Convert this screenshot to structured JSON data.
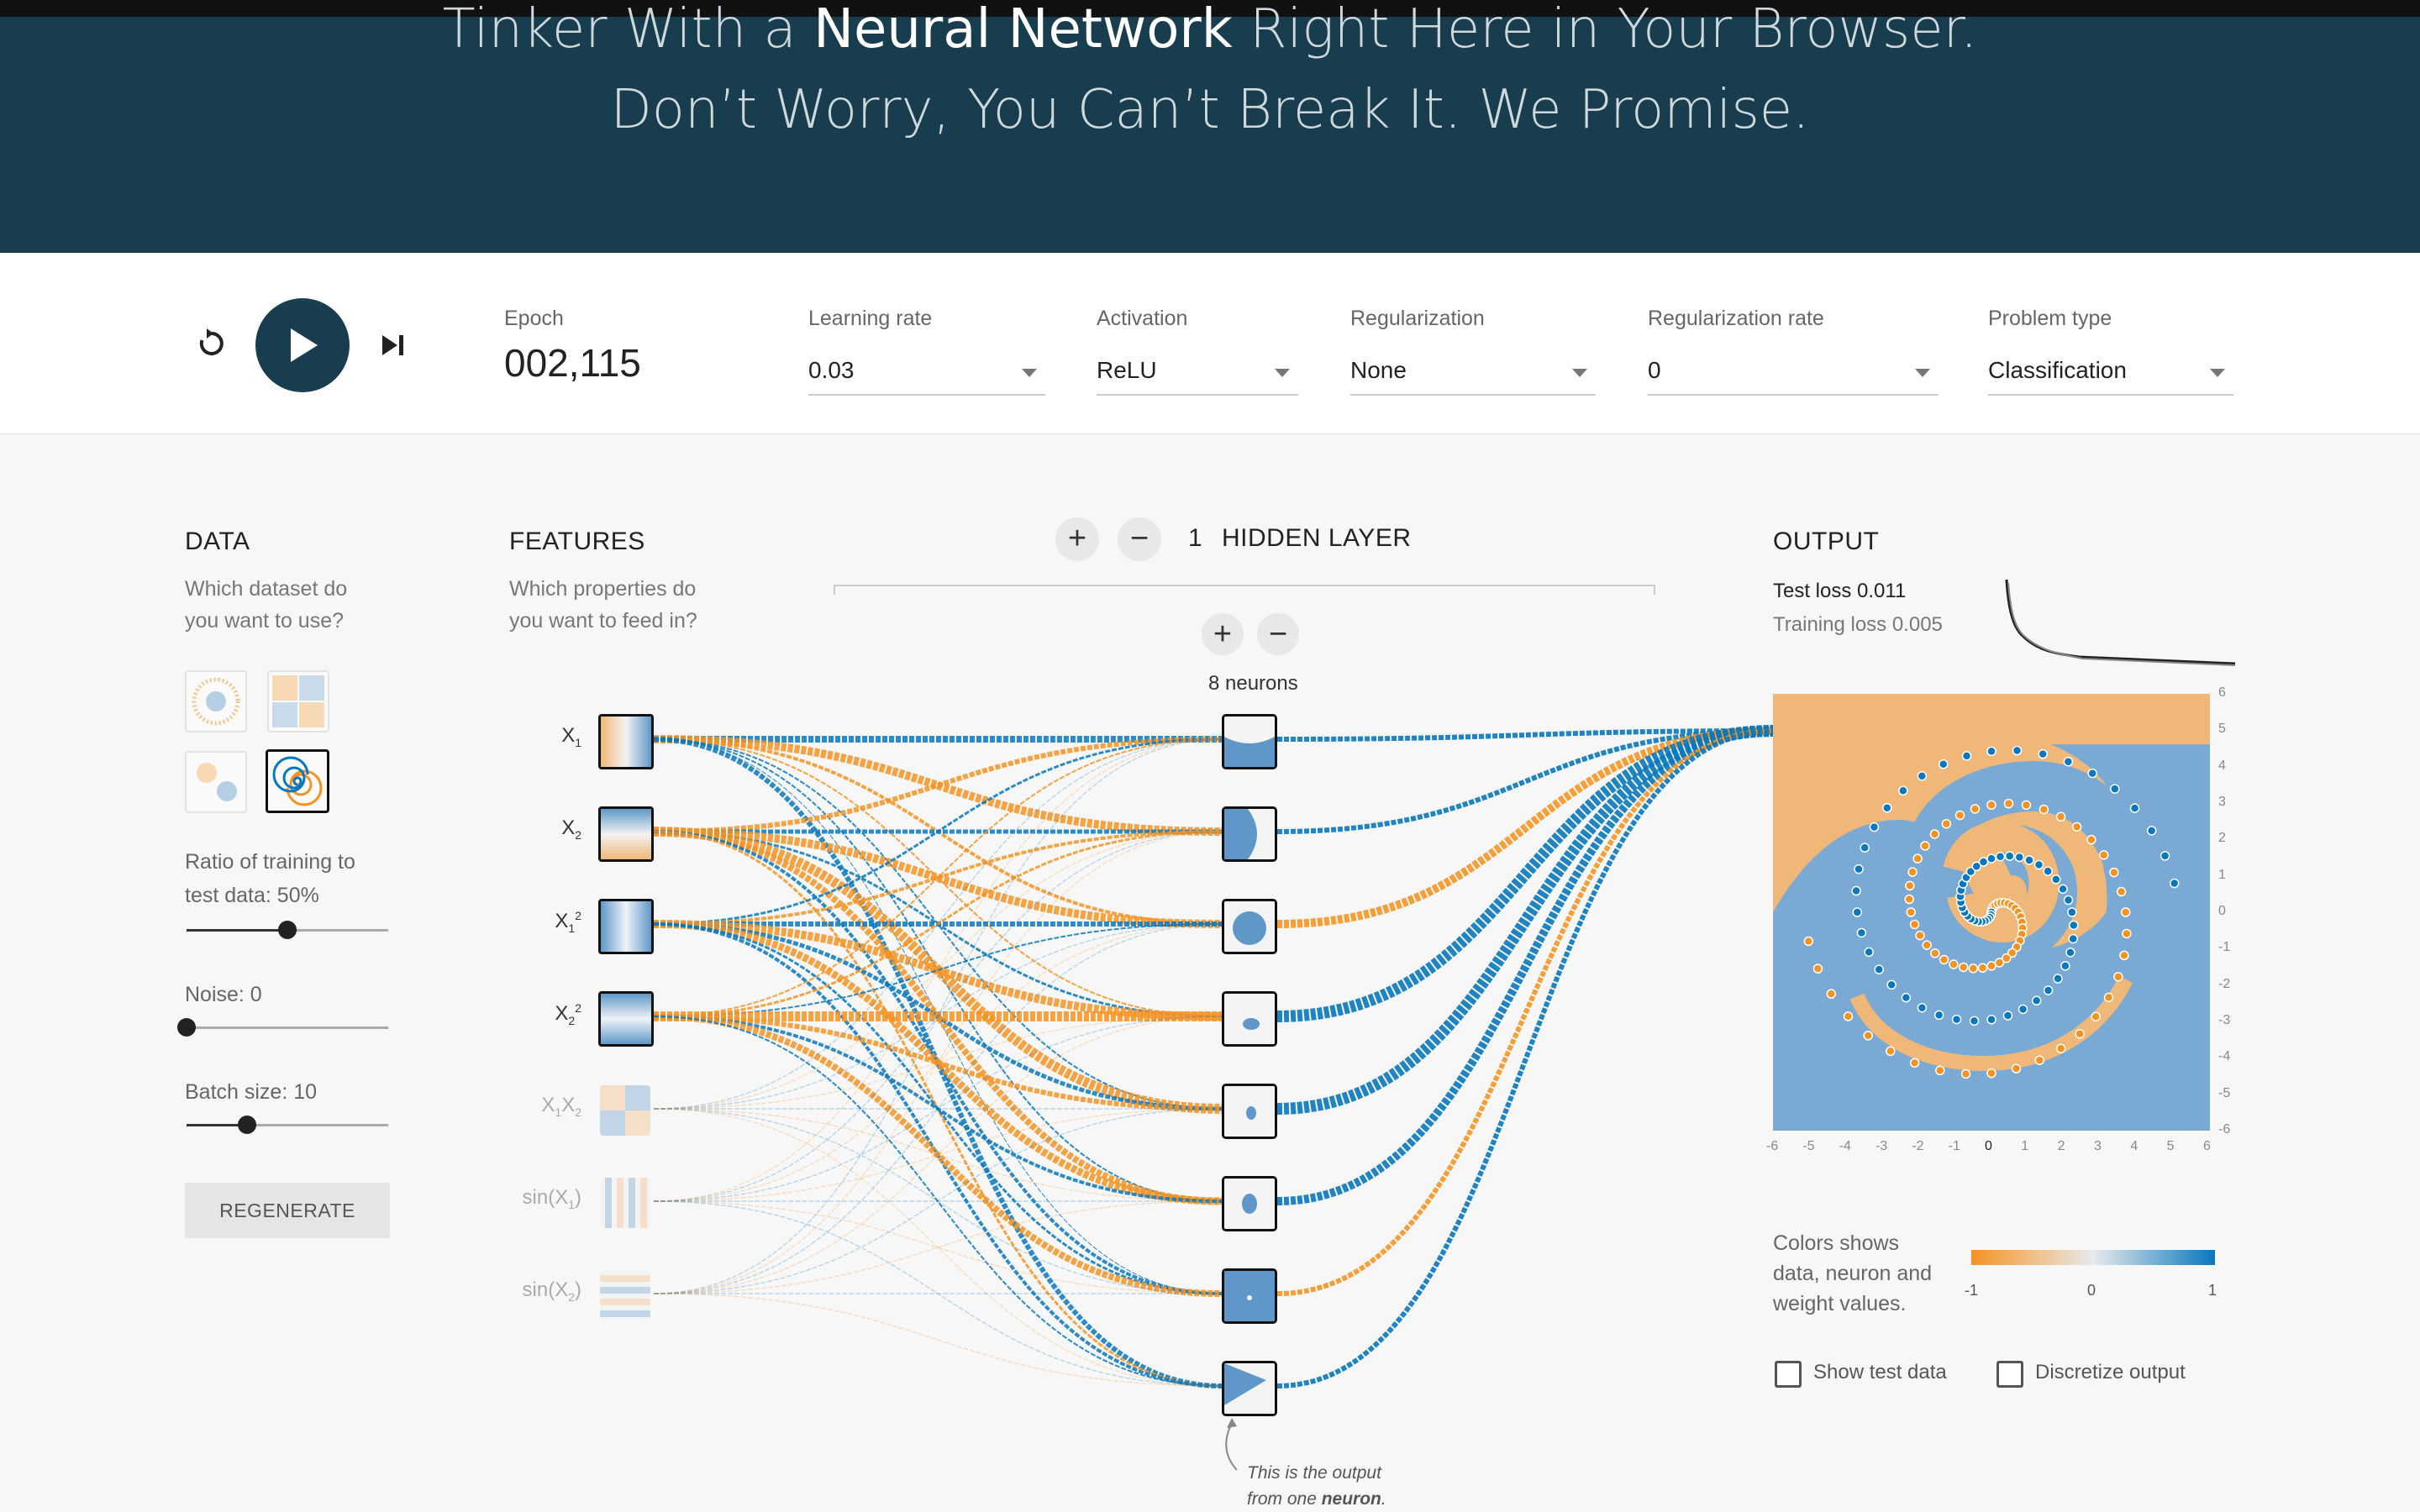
{
  "hero": {
    "line1_pre": "Tinker With a ",
    "line1_bold": "Neural Network",
    "line1_post": " Right Here in Your Browser.",
    "line2": "Don’t Worry, You Can’t Break It. We Promise."
  },
  "controls": {
    "epoch_label": "Epoch",
    "epoch_value": "002,115",
    "learning_rate": {
      "label": "Learning rate",
      "value": "0.03"
    },
    "activation": {
      "label": "Activation",
      "value": "ReLU"
    },
    "regularization": {
      "label": "Regularization",
      "value": "None"
    },
    "regularization_rate": {
      "label": "Regularization rate",
      "value": "0"
    },
    "problem_type": {
      "label": "Problem type",
      "value": "Classification"
    }
  },
  "data_panel": {
    "heading": "DATA",
    "desc1": "Which dataset do",
    "desc2": "you want to use?",
    "ratio_label": "Ratio of training to",
    "ratio_label2": "test data:  50%",
    "ratio_value": 0.5,
    "noise_label": "Noise:  0",
    "noise_value": 0,
    "batch_label": "Batch size:  10",
    "batch_value": 0.3,
    "regenerate": "REGENERATE"
  },
  "features_panel": {
    "heading": "FEATURES",
    "desc1": "Which properties do",
    "desc2": "you want to feed in?",
    "features": [
      "X1",
      "X2",
      "X1²",
      "X2²",
      "X1X2",
      "sin(X1)",
      "sin(X2)"
    ]
  },
  "hidden": {
    "count": "1",
    "title": "HIDDEN LAYER",
    "neurons_label": "8 neurons",
    "annotation1": "This is the output",
    "annotation2_pre": "from one ",
    "annotation2_bold": "neuron",
    "annotation2_post": "."
  },
  "output_panel": {
    "heading": "OUTPUT",
    "test_loss": "Test loss 0.011",
    "training_loss": "Training loss 0.005",
    "axis_ticks": [
      "-6",
      "-5",
      "-4",
      "-3",
      "-2",
      "-1",
      "0",
      "1",
      "2",
      "3",
      "4",
      "5",
      "6"
    ],
    "legend_desc1": "Colors shows",
    "legend_desc2": "data, neuron and",
    "legend_desc3": "weight values.",
    "legend_min": "-1",
    "legend_mid": "0",
    "legend_max": "1",
    "show_test_data": "Show test data",
    "discretize_output": "Discretize output"
  },
  "colors": {
    "orange": "#f59322",
    "blue": "#0877bd",
    "dark": "#183d4e"
  }
}
